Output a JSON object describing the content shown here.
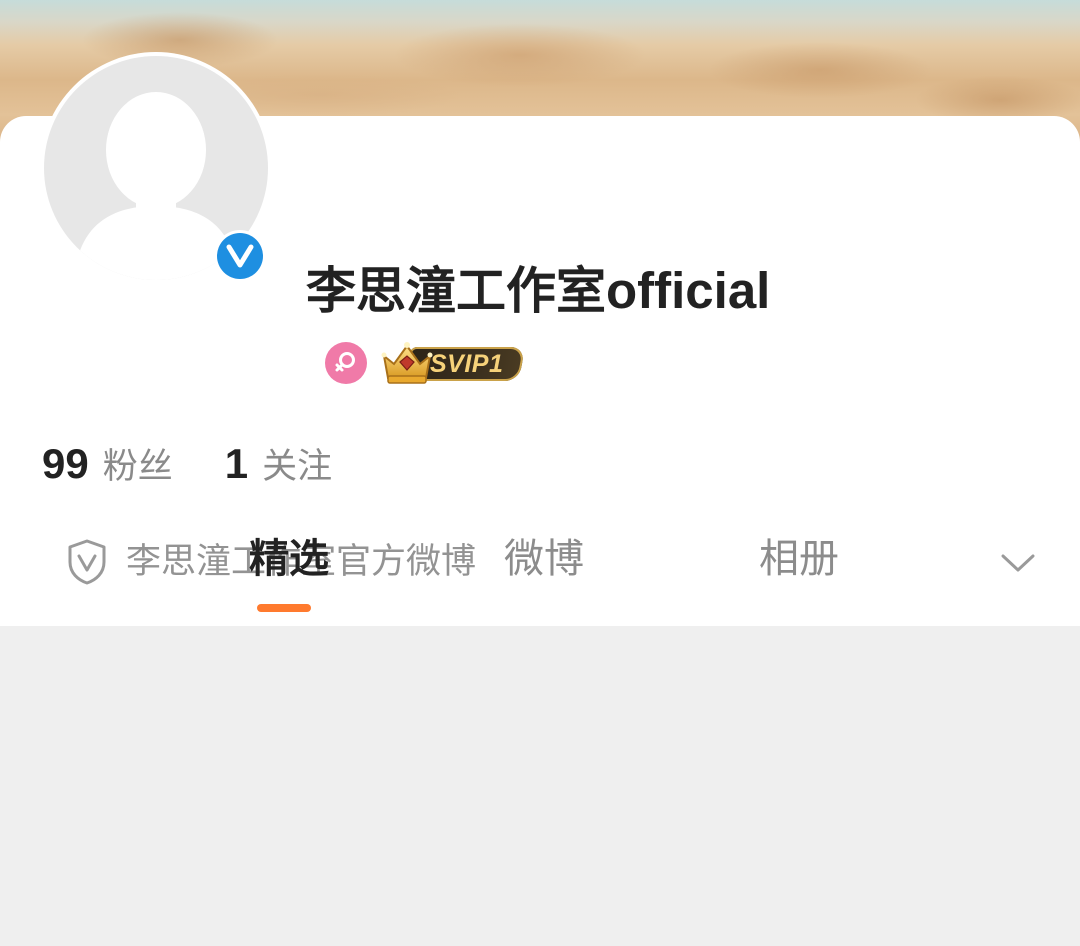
{
  "profile": {
    "name_cn": "李思潼工作室",
    "name_en": "official",
    "gender_icon": "female-icon",
    "vip_badge": "SVIP1",
    "verified_icon": "verified-v-icon"
  },
  "stats": {
    "followers_count": "99",
    "followers_label": "粉丝",
    "following_count": "1",
    "following_label": "关注"
  },
  "description": {
    "text": "李思潼工作室官方微博",
    "shield_icon": "shield-v-icon",
    "expand_icon": "chevron-down-icon"
  },
  "tabs": [
    {
      "label": "精选",
      "active": true
    },
    {
      "label": "微博",
      "active": false
    },
    {
      "label": "相册",
      "active": false
    }
  ],
  "colors": {
    "accent": "#ff7a2e",
    "verified_blue": "#1e8fe1",
    "female_pink": "#f07aa8",
    "background_gray": "#efefef"
  }
}
